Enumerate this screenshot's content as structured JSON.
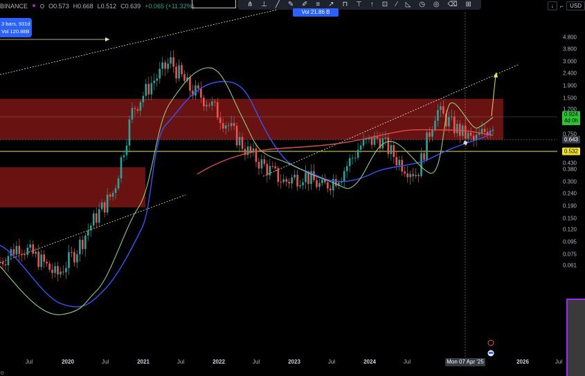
{
  "header": {
    "exchange": "BINANCE",
    "open": "O0.573",
    "high": "H0.668",
    "low": "L0.512",
    "close": "C0.639",
    "change": "+0.065 (+11.32%)"
  },
  "toolbar": {
    "volume_pill": "Vol 21.86 B",
    "currency": "USD",
    "tools": [
      "pitchfork-tool",
      "vertical-line-tool",
      "trend-line-tool",
      "brush-tool",
      "pen-tool",
      "fib-tool",
      "ray-tool",
      "text-tool",
      "fork-tool",
      "arrow-tool",
      "flag-tool",
      "ruler-tool",
      "target-tool",
      "triangle-tool",
      "circle-tool",
      "eraser-tool",
      "grid-tool"
    ]
  },
  "selection_info": {
    "bars": "3 bars, 931d",
    "volume": "Vol 120.88B"
  },
  "price_axis": [
    "4.800",
    "3.800",
    "3.000",
    "2.400",
    "1.900",
    "1.500",
    "1.200",
    "0.924",
    "0.750",
    "0.643",
    "0.532",
    "0.430",
    "0.380",
    "0.300",
    "0.240",
    "0.190",
    "0.150",
    "0.120",
    "0.095",
    "0.075",
    "0.061"
  ],
  "price_tags": {
    "current": {
      "value": "0.924",
      "sub": "4d 0h",
      "color": "#26c62f"
    },
    "crosshair": {
      "value": "0.643",
      "color": "#363a45"
    },
    "level": {
      "value": "0.532",
      "color": "#f2e022"
    }
  },
  "time_axis": [
    {
      "label": "Jul",
      "year": false
    },
    {
      "label": "2020",
      "year": true
    },
    {
      "label": "Jul",
      "year": false
    },
    {
      "label": "2021",
      "year": true
    },
    {
      "label": "Jul",
      "year": false
    },
    {
      "label": "2022",
      "year": true
    },
    {
      "label": "Jul",
      "year": false
    },
    {
      "label": "2023",
      "year": true
    },
    {
      "label": "Jul",
      "year": false
    },
    {
      "label": "2024",
      "year": true
    },
    {
      "label": "Jul",
      "year": false
    },
    {
      "label": "2026",
      "year": true
    },
    {
      "label": "Jul",
      "year": false
    }
  ],
  "crosshair_date": "Mon 07 Apr '25",
  "colors": {
    "background": "#000000",
    "zone_red": "#8b1a1a",
    "ma_blue": "#3355ff",
    "ma_green": "#8fd17a",
    "ma_red": "#e04a4a",
    "level_yellow": "#e8e84a",
    "candle_up": "#26a69a",
    "candle_down": "#ef5350"
  },
  "chart_data": {
    "type": "candlestick",
    "scale": "log",
    "series": [
      {
        "name": "price",
        "values": [
          0.065,
          0.09,
          0.07,
          0.05,
          0.08,
          0.15,
          0.25,
          1.2,
          2.0,
          3.0,
          1.8,
          1.4,
          0.9,
          0.55,
          0.4,
          0.3,
          0.35,
          0.27,
          0.35,
          0.6,
          0.7,
          0.45,
          0.35,
          1.2,
          0.85,
          0.65,
          0.924
        ]
      }
    ]
  }
}
